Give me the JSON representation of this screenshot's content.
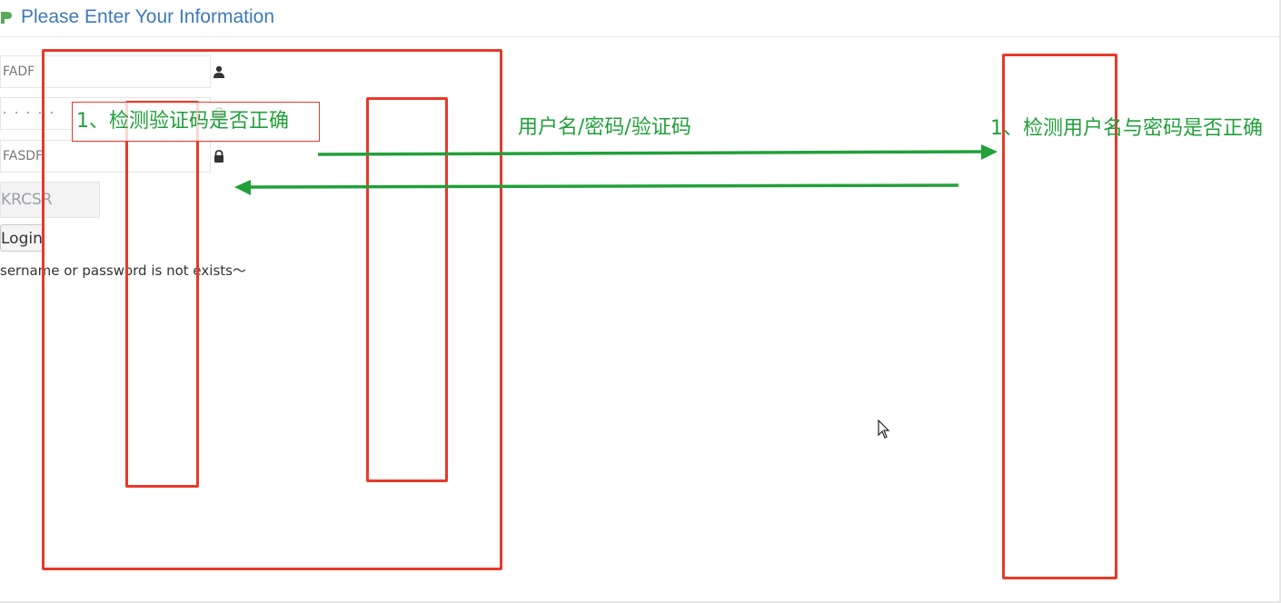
{
  "header": {
    "title": "Please Enter Your Information",
    "icon": "leaf-icon"
  },
  "form": {
    "username_value": "FADF",
    "password_value": "· · · · ·",
    "captcha_value": "FASDF",
    "captcha_image_text": "KRCSR",
    "login_label": "Login",
    "error_message": "sername or password is not exists～"
  },
  "annotations": {
    "client_check": "1、检测验证码是否正确",
    "flow_label": "用户名/密码/验证码",
    "server_check": "1、检测用户名与密码是否正确"
  },
  "colors": {
    "annotation_red": "#e8392a",
    "annotation_green": "#22a03a",
    "title_blue": "#3d7ab8"
  }
}
